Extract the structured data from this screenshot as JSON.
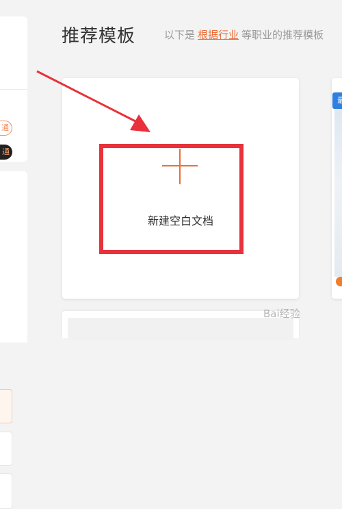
{
  "header": {
    "title": "推荐模板",
    "subtitle_prefix": "以下是",
    "industry_link": "根据行业",
    "subtitle_suffix": "等职业的推荐模板"
  },
  "sidebar": {
    "pill_outline": "通",
    "pill_filled": "通"
  },
  "blank_template": {
    "label": "新建空白文档",
    "plus_icon": "plus-icon"
  },
  "side_template": {
    "badge": "最"
  },
  "watermark": "Bai经验",
  "colors": {
    "accent": "#e96f3a",
    "highlight": "#e8313b",
    "badge_blue": "#2f7fe0"
  }
}
